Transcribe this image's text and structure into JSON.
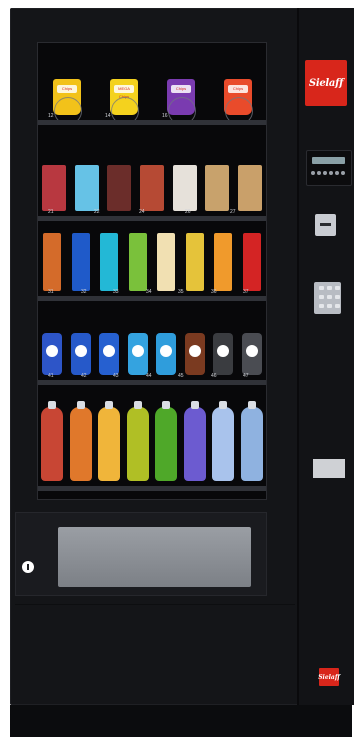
{
  "machine": {
    "brand": "Sielaff",
    "brand_small": "Sielaff",
    "colors": {
      "body": "#141518",
      "brand_red": "#d8261b"
    }
  },
  "shelves": [
    {
      "labels": [
        "12",
        "14",
        "16"
      ],
      "items": [
        {
          "kind": "chips",
          "color": "#f2c21a",
          "text": "Chips"
        },
        {
          "kind": "chips",
          "color": "#f4d21e",
          "text": "MEGA Chips"
        },
        {
          "kind": "chips",
          "color": "#7a3bb0",
          "text": "Chips"
        },
        {
          "kind": "chips",
          "color": "#e94b2b",
          "text": "Chips"
        }
      ]
    },
    {
      "labels": [
        "21",
        "22",
        "24",
        "26",
        "27"
      ],
      "items": [
        {
          "kind": "snack",
          "color": "#b83840"
        },
        {
          "kind": "snack",
          "color": "#66c2e6"
        },
        {
          "kind": "snack",
          "color": "#6b2d2a"
        },
        {
          "kind": "snack",
          "color": "#b64a34"
        },
        {
          "kind": "snack",
          "color": "#e6e1da"
        },
        {
          "kind": "snack",
          "color": "#c8a26c"
        },
        {
          "kind": "snack",
          "color": "#c9a06a"
        }
      ]
    },
    {
      "labels": [
        "31",
        "32",
        "33",
        "34",
        "35",
        "36",
        "37"
      ],
      "items": [
        {
          "kind": "bar",
          "color": "#d46b2a"
        },
        {
          "kind": "bar",
          "color": "#1f5ac9"
        },
        {
          "kind": "bar",
          "color": "#23b8d6"
        },
        {
          "kind": "bar",
          "color": "#7ac13b"
        },
        {
          "kind": "bar",
          "color": "#f1e0b2"
        },
        {
          "kind": "bar",
          "color": "#e5c33a"
        },
        {
          "kind": "bar",
          "color": "#f09a2c"
        },
        {
          "kind": "bar",
          "color": "#d42424"
        }
      ]
    },
    {
      "labels": [
        "41",
        "42",
        "43",
        "44",
        "45",
        "46",
        "47"
      ],
      "items": [
        {
          "kind": "can",
          "color": "#2d55c8"
        },
        {
          "kind": "can",
          "color": "#2659c9"
        },
        {
          "kind": "can",
          "color": "#2660d0"
        },
        {
          "kind": "can",
          "color": "#34a3e0"
        },
        {
          "kind": "can",
          "color": "#2f9ddc"
        },
        {
          "kind": "can",
          "color": "#7a3a20"
        },
        {
          "kind": "can",
          "color": "#3a3c40"
        },
        {
          "kind": "can",
          "color": "#4a4c52"
        }
      ]
    },
    {
      "labels": [],
      "items": [
        {
          "kind": "bottle",
          "color": "#c84634"
        },
        {
          "kind": "bottle",
          "color": "#e0782b"
        },
        {
          "kind": "bottle",
          "color": "#f0b53a"
        },
        {
          "kind": "bottle",
          "color": "#b0bf25"
        },
        {
          "kind": "bottle",
          "color": "#4fa829"
        },
        {
          "kind": "bottle",
          "color": "#6c5bd0"
        },
        {
          "kind": "bottle",
          "color": "#a9c3ec"
        },
        {
          "kind": "bottle",
          "color": "#8fb2e0"
        }
      ]
    }
  ]
}
